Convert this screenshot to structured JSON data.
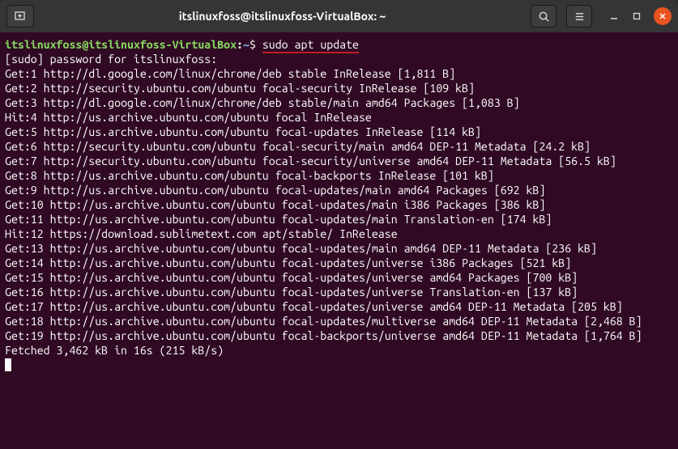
{
  "titlebar": {
    "title": "itslinuxfoss@itslinuxfoss-VirtualBox: ~"
  },
  "prompt": {
    "user_host": "itslinuxfoss@itslinuxfoss-VirtualBox",
    "sep1": ":",
    "path": "~",
    "dollar": "$ "
  },
  "command": "sudo apt update",
  "output": [
    "[sudo] password for itslinuxfoss:",
    "Get:1 http://dl.google.com/linux/chrome/deb stable InRelease [1,811 B]",
    "Get:2 http://security.ubuntu.com/ubuntu focal-security InRelease [109 kB]",
    "Get:3 http://dl.google.com/linux/chrome/deb stable/main amd64 Packages [1,083 B]",
    "Hit:4 http://us.archive.ubuntu.com/ubuntu focal InRelease",
    "Get:5 http://us.archive.ubuntu.com/ubuntu focal-updates InRelease [114 kB]",
    "Get:6 http://security.ubuntu.com/ubuntu focal-security/main amd64 DEP-11 Metadata [24.2 kB]",
    "Get:7 http://security.ubuntu.com/ubuntu focal-security/universe amd64 DEP-11 Metadata [56.5 kB]",
    "Get:8 http://us.archive.ubuntu.com/ubuntu focal-backports InRelease [101 kB]",
    "Get:9 http://us.archive.ubuntu.com/ubuntu focal-updates/main amd64 Packages [692 kB]",
    "Get:10 http://us.archive.ubuntu.com/ubuntu focal-updates/main i386 Packages [386 kB]",
    "Get:11 http://us.archive.ubuntu.com/ubuntu focal-updates/main Translation-en [174 kB]",
    "Hit:12 https://download.sublimetext.com apt/stable/ InRelease",
    "Get:13 http://us.archive.ubuntu.com/ubuntu focal-updates/main amd64 DEP-11 Metadata [236 kB]",
    "Get:14 http://us.archive.ubuntu.com/ubuntu focal-updates/universe i386 Packages [521 kB]",
    "Get:15 http://us.archive.ubuntu.com/ubuntu focal-updates/universe amd64 Packages [700 kB]",
    "Get:16 http://us.archive.ubuntu.com/ubuntu focal-updates/universe Translation-en [137 kB]",
    "Get:17 http://us.archive.ubuntu.com/ubuntu focal-updates/universe amd64 DEP-11 Metadata [205 kB]",
    "Get:18 http://us.archive.ubuntu.com/ubuntu focal-updates/multiverse amd64 DEP-11 Metadata [2,468 B]",
    "Get:19 http://us.archive.ubuntu.com/ubuntu focal-backports/universe amd64 DEP-11 Metadata [1,764 B]",
    "Fetched 3,462 kB in 16s (215 kB/s)"
  ]
}
